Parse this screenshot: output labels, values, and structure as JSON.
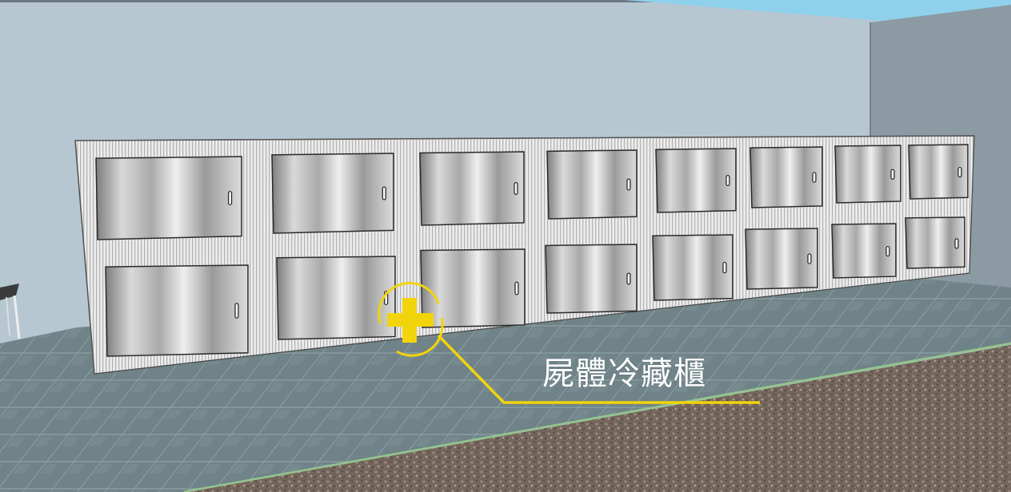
{
  "scene": {
    "annotation": {
      "label": "屍體冷藏櫃",
      "marker": "crosshair-target-icon",
      "color": "#f2d40c"
    },
    "cabinet": {
      "top_row_doors": 8,
      "bottom_row_doors": 8,
      "door_color": "#c9c9c9",
      "frame_color": "#e6e6e6"
    },
    "colors": {
      "wall": "#b6c6d0",
      "side_wall": "#8c9aa3",
      "floor": "#6e8288",
      "ground": "#7a6a62",
      "sky": "#8fd0ec"
    }
  }
}
